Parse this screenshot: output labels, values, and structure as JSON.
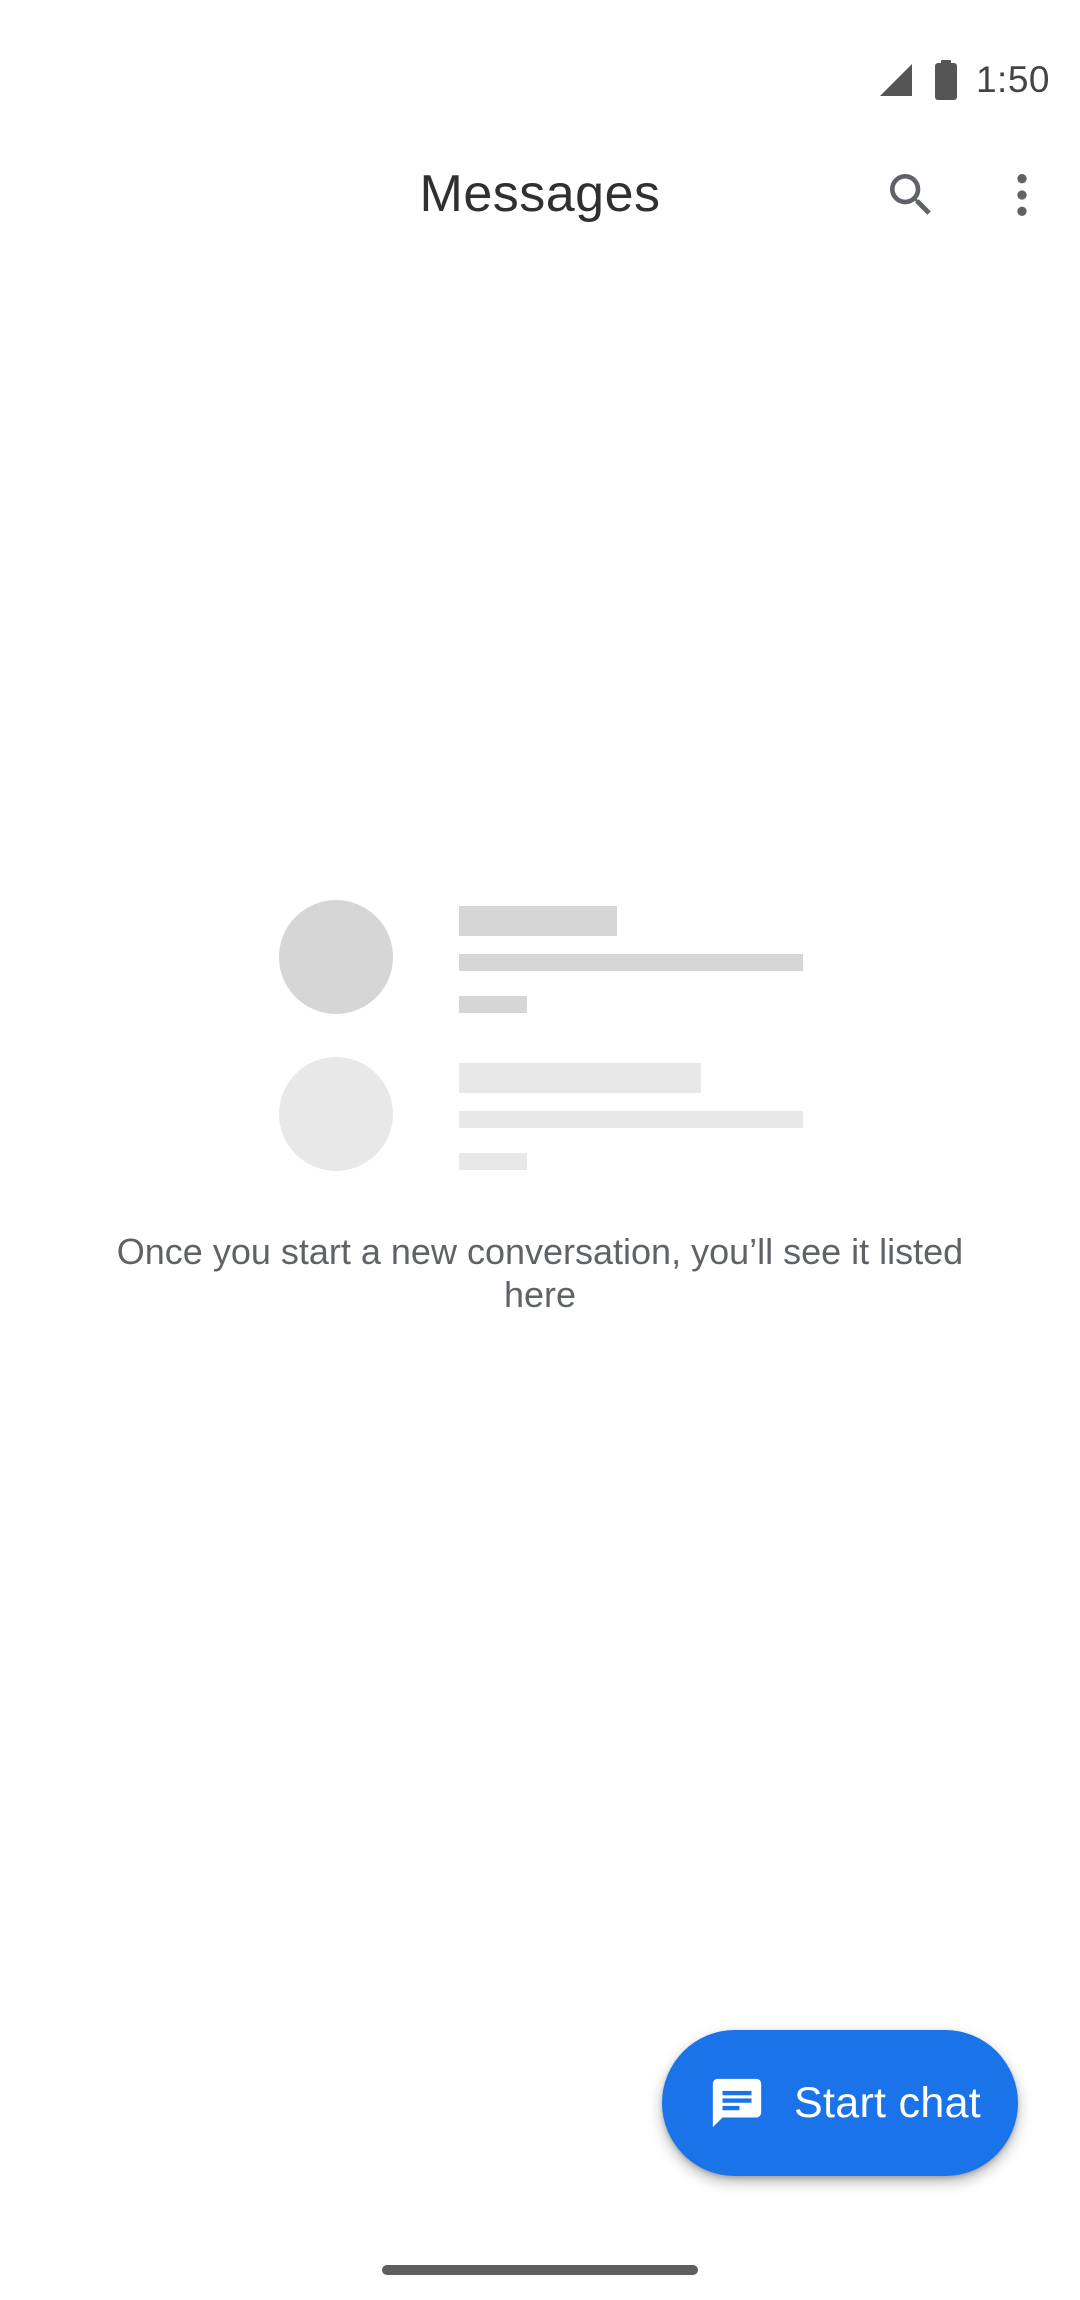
{
  "status_bar": {
    "time": "1:50",
    "icons": [
      "cell-signal-icon",
      "battery-icon"
    ]
  },
  "app_bar": {
    "title": "Messages",
    "actions": [
      "search-icon",
      "more-vert-icon"
    ]
  },
  "empty_state": {
    "message": "Once you start a new conversation, you’ll see it listed here"
  },
  "fab": {
    "label": "Start chat",
    "icon": "chat-bubble-icon"
  },
  "colors": {
    "accent": "#1a73e8",
    "placeholder_dark": "#d6d6d6",
    "placeholder_light": "#e8e8e8",
    "text_secondary": "#5f6368",
    "icon_gray": "#5f6368"
  }
}
